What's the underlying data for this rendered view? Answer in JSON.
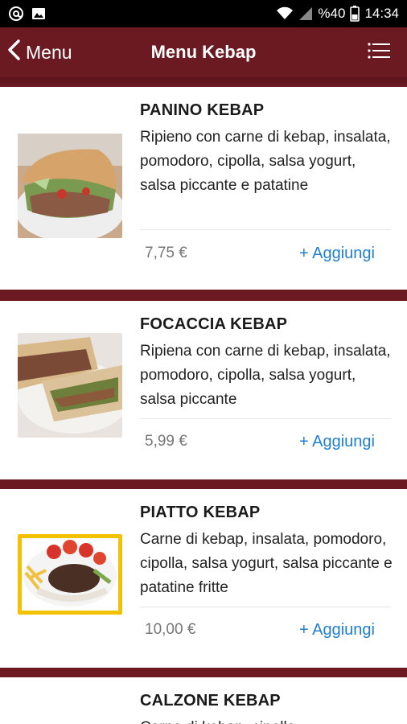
{
  "status_bar": {
    "battery_text": "%40",
    "time": "14:34"
  },
  "app_bar": {
    "back_label": "Menu",
    "title": "Menu Kebap"
  },
  "items": [
    {
      "name": "PANINO KEBAP",
      "description": "Ripieno con carne di kebap, insalata, pomodoro, cipolla, salsa yogurt, salsa piccante e patatine",
      "price": "7,75 €",
      "add_label": "+ Aggiungi"
    },
    {
      "name": "FOCACCIA KEBAP",
      "description": "Ripiena con carne di kebap, insalata, pomodoro, cipolla, salsa yogurt, salsa piccante",
      "price": "5,99 €",
      "add_label": "+ Aggiungi"
    },
    {
      "name": "PIATTO KEBAP",
      "description": "Carne di kebap, insalata, pomodoro, cipolla, salsa yogurt, salsa piccante e patatine fritte",
      "price": "10,00 €",
      "add_label": "+ Aggiungi"
    },
    {
      "name": "CALZONE KEBAP",
      "description": "Carne di kebap, cipolla",
      "price": "",
      "add_label": ""
    }
  ],
  "colors": {
    "brand": "#6b1a22",
    "accent_link": "#1f7fd0"
  }
}
